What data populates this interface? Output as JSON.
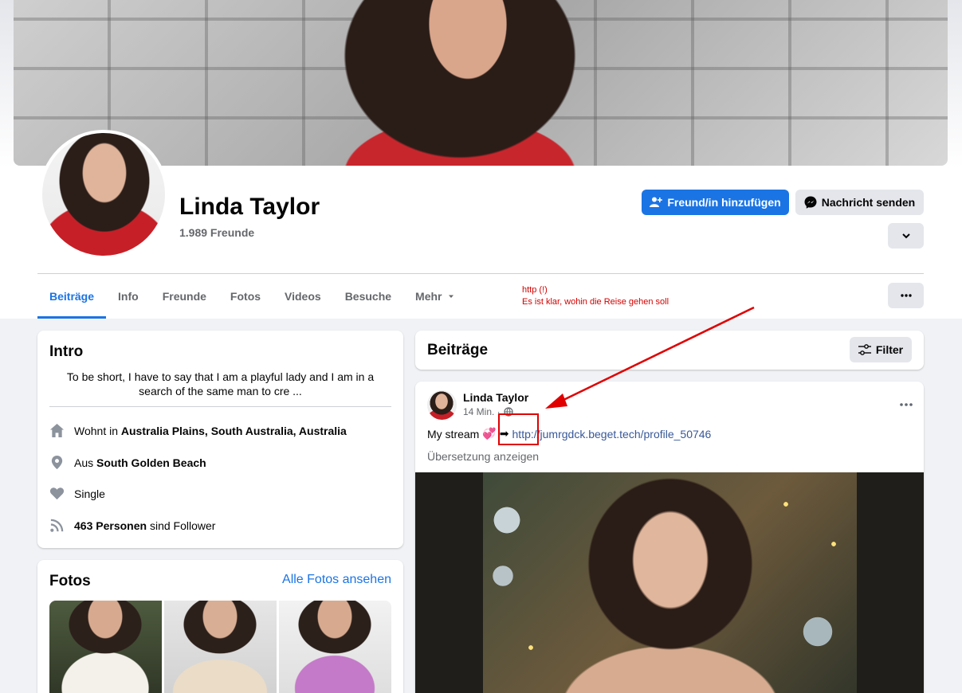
{
  "profile": {
    "name": "Linda Taylor",
    "friends": "1.989 Freunde"
  },
  "actions": {
    "add_friend": "Freund/in hinzufügen",
    "message": "Nachricht senden"
  },
  "tabs": [
    "Beiträge",
    "Info",
    "Freunde",
    "Fotos",
    "Videos",
    "Besuche",
    "Mehr"
  ],
  "annotation": {
    "line1": "http (!)",
    "line2": "Es ist klar, wohin die Reise gehen soll"
  },
  "intro": {
    "title": "Intro",
    "bio": "To be short, I have to say that I am a playful lady and I am in a search of the same man to cre ...",
    "lives_in_prefix": "Wohnt in",
    "lives_in": "Australia Plains, South Australia, Australia",
    "from_prefix": "Aus",
    "from": "South Golden Beach",
    "relationship": "Single",
    "followers_count": "463 Personen",
    "followers_suffix": "sind Follower"
  },
  "photos": {
    "title": "Fotos",
    "see_all": "Alle Fotos ansehen"
  },
  "posts": {
    "title": "Beiträge",
    "filter": "Filter"
  },
  "post": {
    "author": "Linda Taylor",
    "time": "14 Min. ·",
    "text": "My stream",
    "emoji": "💞",
    "arrow": "➡",
    "link": "http://jumrgdck.beget.tech/profile_50746",
    "translate": "Übersetzung anzeigen"
  },
  "colors": {
    "accent": "#1b74e4",
    "annotation": "#e00000",
    "background": "#f0f2f5"
  }
}
